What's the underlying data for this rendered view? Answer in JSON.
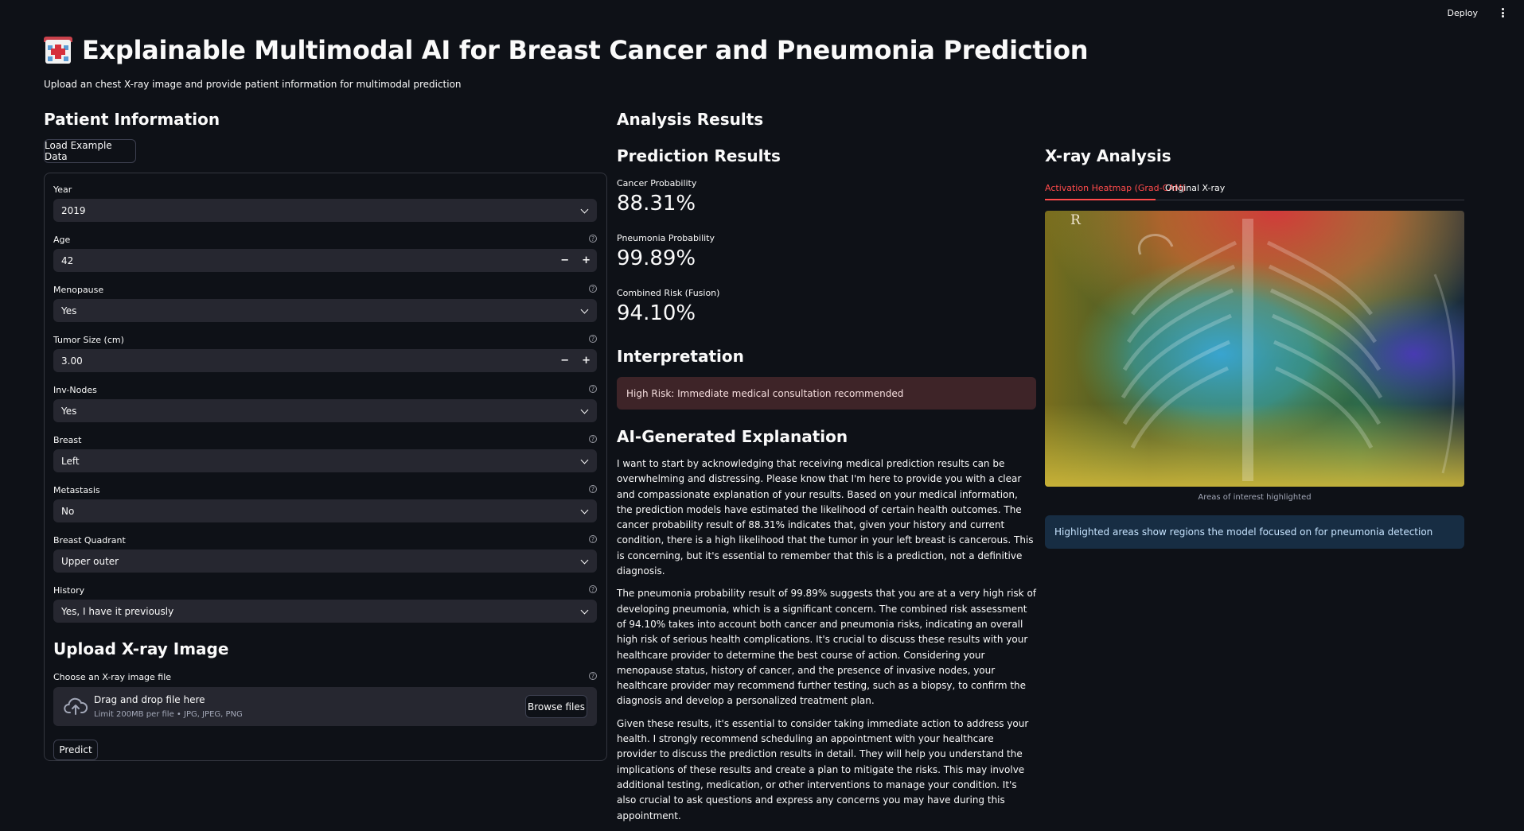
{
  "header": {
    "deploy_label": "Deploy",
    "menu_icon": "kebab-menu-icon"
  },
  "title": "Explainable Multimodal AI for Breast Cancer and Pneumonia Prediction",
  "title_icon": "hospital-icon",
  "subtitle": "Upload an chest X-ray image and provide patient information for multimodal prediction",
  "patient": {
    "heading": "Patient Information",
    "load_example_label": "Load Example Data",
    "fields": {
      "year": {
        "label": "Year",
        "value": "2019"
      },
      "age": {
        "label": "Age",
        "value": "42"
      },
      "menopause": {
        "label": "Menopause",
        "value": "Yes"
      },
      "tumor_size": {
        "label": "Tumor Size (cm)",
        "value": "3.00"
      },
      "inv_nodes": {
        "label": "Inv-Nodes",
        "value": "Yes"
      },
      "breast": {
        "label": "Breast",
        "value": "Left"
      },
      "metastasis": {
        "label": "Metastasis",
        "value": "No"
      },
      "quadrant": {
        "label": "Breast Quadrant",
        "value": "Upper outer"
      },
      "history": {
        "label": "History",
        "value": "Yes, I have it previously"
      }
    },
    "stepper": {
      "minus": "−",
      "plus": "+"
    },
    "help_glyph": "?"
  },
  "upload": {
    "heading": "Upload X-ray Image",
    "label": "Choose an X-ray image file",
    "drop_text": "Drag and drop file here",
    "limit_text": "Limit 200MB per file • JPG, JPEG, PNG",
    "browse_label": "Browse files",
    "predict_label": "Predict"
  },
  "analysis": {
    "heading": "Analysis Results",
    "prediction_heading": "Prediction Results",
    "metrics": [
      {
        "label": "Cancer Probability",
        "value": "88.31%"
      },
      {
        "label": "Pneumonia Probability",
        "value": "99.89%"
      },
      {
        "label": "Combined Risk (Fusion)",
        "value": "94.10%"
      }
    ],
    "interpretation_heading": "Interpretation",
    "interpretation_alert": "High Risk: Immediate medical consultation recommended",
    "explanation_heading": "AI-Generated Explanation",
    "explanation": [
      "I want to start by acknowledging that receiving medical prediction results can be overwhelming and distressing. Please know that I'm here to provide you with a clear and compassionate explanation of your results. Based on your medical information, the prediction models have estimated the likelihood of certain health outcomes. The cancer probability result of 88.31% indicates that, given your history and current condition, there is a high likelihood that the tumor in your left breast is cancerous. This is concerning, but it's essential to remember that this is a prediction, not a definitive diagnosis.",
      "The pneumonia probability result of 99.89% suggests that you are at a very high risk of developing pneumonia, which is a significant concern. The combined risk assessment of 94.10% takes into account both cancer and pneumonia risks, indicating an overall high risk of serious health complications. It's crucial to discuss these results with your healthcare provider to determine the best course of action. Considering your menopause status, history of cancer, and the presence of invasive nodes, your healthcare provider may recommend further testing, such as a biopsy, to confirm the diagnosis and develop a personalized treatment plan.",
      "Given these results, it's essential to consider taking immediate action to address your health. I strongly recommend scheduling an appointment with your healthcare provider to discuss the prediction results in detail. They will help you understand the implications of these results and create a plan to mitigate the risks. This may involve additional testing, medication, or other interventions to manage your condition. It's also crucial to ask questions and express any concerns you may have during this appointment."
    ]
  },
  "xray": {
    "heading": "X-ray Analysis",
    "tabs": [
      "Activation Heatmap (Grad-CAM)",
      "Original X-ray"
    ],
    "image_marker": "R",
    "caption": "Areas of interest highlighted",
    "info": "Highlighted areas show regions the model focused on for pneumonia detection"
  },
  "colors": {
    "background": "#0e1117",
    "accent": "#ff4b4b",
    "field_bg": "#262730",
    "alert_bg": "#3e2428",
    "info_bg": "#172d43"
  }
}
